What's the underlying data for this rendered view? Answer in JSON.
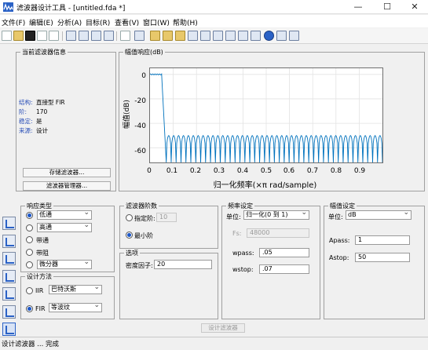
{
  "window": {
    "title": "滤波器设计工具 - [untitled.fda *]",
    "minimize": "—",
    "maximize": "☐",
    "close": "✕"
  },
  "menu": [
    "文件(F)",
    "编辑(E)",
    "分析(A)",
    "目标(R)",
    "查看(V)",
    "窗口(W)",
    "帮助(H)"
  ],
  "toolbar_icons": [
    "new-icon",
    "open-icon",
    "save-icon",
    "print-icon",
    "print-preview-icon",
    "zoom-in-icon",
    "zoom-x-icon",
    "zoom-y-icon",
    "full-view-icon",
    "new-figure-icon",
    "filter-spec-icon",
    "magnitude-response-icon",
    "phase-response-icon",
    "magnitude-phase-icon",
    "group-delay-icon",
    "phase-delay-icon",
    "impulse-response-icon",
    "step-response-icon",
    "pole-zero-icon",
    "coefficients-icon",
    "info-icon",
    "cost-icon",
    "help-icon"
  ],
  "info": {
    "legend": "当前滤波器信息",
    "rows": [
      {
        "key": "结构:",
        "value": "直接型 FIR"
      },
      {
        "key": "阶:",
        "value": "170"
      },
      {
        "key": "稳定:",
        "value": "是"
      },
      {
        "key": "来源:",
        "value": "设计"
      }
    ],
    "store_button": "存储滤波器...",
    "manager_button": "滤波器管理器..."
  },
  "plot": {
    "legend": "幅值响应(dB)",
    "ylabel": "幅值(dB)",
    "xlabel": "归一化频率(×π rad/sample)",
    "yticks": [
      "0",
      "-20",
      "-40",
      "-60"
    ],
    "xticks": [
      "0",
      "0.1",
      "0.2",
      "0.3",
      "0.4",
      "0.5",
      "0.6",
      "0.7",
      "0.8",
      "0.9"
    ]
  },
  "chart_data": {
    "type": "line",
    "title": "幅值响应(dB)",
    "xlabel": "归一化频率(×π rad/sample)",
    "ylabel": "幅值(dB)",
    "xlim": [
      0,
      1
    ],
    "ylim": [
      -72,
      5
    ],
    "grid": true,
    "series": [
      {
        "passband_edge": 0.05,
        "stopband_edge": 0.07,
        "passband_level": 0,
        "stopband_floor": -72,
        "stopband_peak": -50,
        "ripple_lobes": 44,
        "color": "#0072bd"
      }
    ]
  },
  "response_type": {
    "legend": "响应类型",
    "options": [
      {
        "label": "低通",
        "selected": true,
        "dropdown": true
      },
      {
        "label": "高通",
        "selected": false,
        "dropdown": true
      },
      {
        "label": "带通",
        "selected": false,
        "dropdown": false
      },
      {
        "label": "带阻",
        "selected": false,
        "dropdown": false
      },
      {
        "label": "微分器",
        "selected": false,
        "dropdown": true
      }
    ]
  },
  "design_method": {
    "legend": "设计方法",
    "iir_label": "IIR",
    "iir_value": "巴特沃斯",
    "fir_label": "FIR",
    "fir_value": "等波纹",
    "selected": "FIR"
  },
  "filter_order": {
    "legend": "滤波器阶数",
    "specify_label": "指定阶:",
    "specify_value": "10",
    "minimum_label": "最小阶",
    "selected": "minimum"
  },
  "options": {
    "legend": "选项",
    "density_label": "密度因子:",
    "density_value": "20"
  },
  "freq_spec": {
    "legend": "频率设定",
    "units_label": "单位:",
    "units_value": "归一化(0 到 1)",
    "fs_label": "Fs:",
    "fs_value": "48000",
    "wpass_label": "wpass:",
    "wpass_value": ".05",
    "wstop_label": "wstop:",
    "wstop_value": ".07"
  },
  "mag_spec": {
    "legend": "幅值设定",
    "units_label": "单位:",
    "units_value": "dB",
    "apass_label": "Apass:",
    "apass_value": "1",
    "astop_label": "Astop:",
    "astop_value": "50"
  },
  "design_button": "设计滤波器",
  "sidebar_icons": [
    "pole-zero-editor-icon",
    "transform-filter-icon",
    "quantize-icon",
    "realize-model-icon",
    "import-filter-icon",
    "multirate-icon",
    "design-filter-icon"
  ],
  "status": "设计滤波器 ... 完成"
}
